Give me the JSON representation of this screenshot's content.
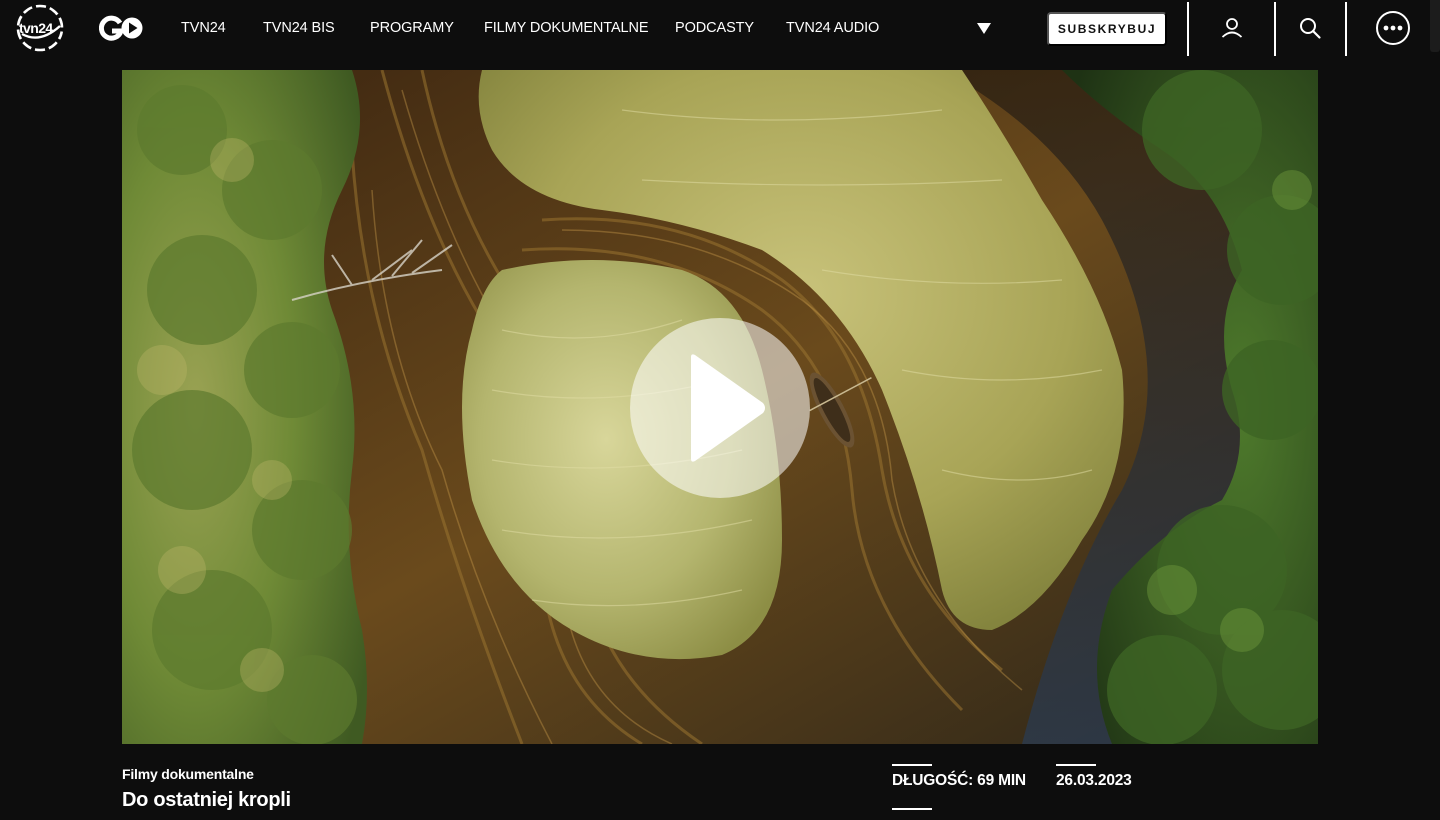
{
  "brand": {
    "logo_text": "tvn24",
    "go_logo_text": "GO"
  },
  "nav": {
    "items": [
      {
        "label": "TVN24"
      },
      {
        "label": "TVN24 BIS"
      },
      {
        "label": "PROGRAMY"
      },
      {
        "label": "FILMY DOKUMENTALNE"
      },
      {
        "label": "PODCASTY"
      },
      {
        "label": "TVN24 AUDIO"
      }
    ],
    "more_icon": "caret-down-icon",
    "subscribe_label": "SUBSKRYBUJ",
    "user_icon": "user-icon",
    "search_icon": "search-icon",
    "menu_icon": "more-dots-icon"
  },
  "player": {
    "play_icon": "play-icon"
  },
  "video": {
    "category": "Filmy dokumentalne",
    "title": "Do ostatniej kropli",
    "duration": "DŁUGOŚĆ: 69 MIN",
    "date": "26.03.2023"
  },
  "colors": {
    "background": "#0d0d0d",
    "text": "#ffffff",
    "button_bg": "#ffffff",
    "button_text": "#111111"
  }
}
